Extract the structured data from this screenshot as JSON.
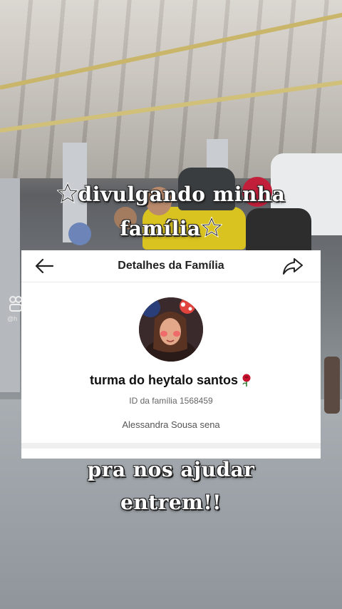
{
  "overlay": {
    "line1": "divulgando minha",
    "line2": "família",
    "line3": "pra nos ajudar",
    "line4": "entrem!!"
  },
  "card": {
    "title": "Detalhes da Família",
    "back_icon": "arrow-left-icon",
    "share_icon": "share-icon",
    "family_name": "turma do heytalo santos",
    "family_id_text": "ID da família 1568459",
    "owner_name": "Alessandra Sousa sena"
  },
  "watermark": {
    "handle": "@h"
  },
  "colors": {
    "text_outline": "#222222",
    "card_bg": "#ffffff",
    "rose": "#c8102e"
  }
}
